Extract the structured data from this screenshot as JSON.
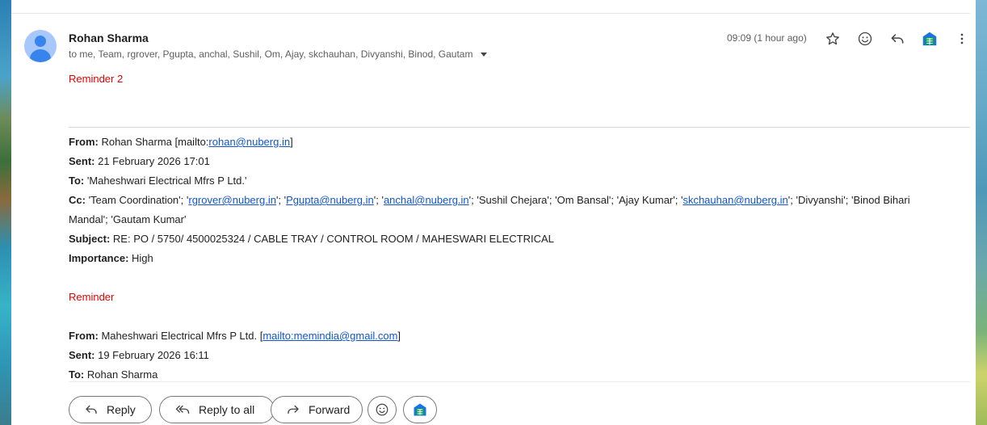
{
  "message": {
    "sender_name": "Rohan Sharma",
    "recipients": "to me, Team, rgrover, Pgupta, anchal, Sushil, Om, Ajay, skchauhan, Divyanshi, Binod, Gautam",
    "time": "09:09 (1 hour ago)",
    "reminder_label": "Reminder 2"
  },
  "quoted1": {
    "from_label": "From:",
    "from_text": " Rohan Sharma [mailto:",
    "from_link": "rohan@nuberg.in",
    "from_close": "]",
    "sent_label": "Sent:",
    "sent_value": " 21 February 2026 17:01",
    "to_label": "To:",
    "to_value": " 'Maheshwari Electrical Mfrs P Ltd.'",
    "cc_label": "Cc:",
    "cc_t1": " 'Team Coordination'; '",
    "cc_l1": "rgrover@nuberg.in",
    "cc_t2": "'; '",
    "cc_l2": "Pgupta@nuberg.in",
    "cc_t3": "'; '",
    "cc_l3": "anchal@nuberg.in",
    "cc_t4": "'; 'Sushil Chejara'; 'Om Bansal'; 'Ajay Kumar'; '",
    "cc_l4": "skchauhan@nuberg.in",
    "cc_t5": "'; 'Divyanshi'; 'Binod Bihari",
    "cc_line2": "Mandal'; 'Gautam Kumar'",
    "subject_label": "Subject:",
    "subject_value": " RE: PO / 5750/ 4500025324 / CABLE TRAY / CONTROL ROOM / MAHESWARI ELECTRICAL",
    "importance_label": "Importance:",
    "importance_value": " High",
    "reminder_label": "Reminder"
  },
  "quoted2": {
    "from_label": "From:",
    "from_text": " Maheshwari Electrical Mfrs P Ltd. [",
    "from_link": "mailto:memindia@gmail.com",
    "from_close": "]",
    "sent_label": "Sent:",
    "sent_value": " 19 February 2026 16:11",
    "to_label": "To:",
    "to_value": " Rohan Sharma"
  },
  "actions": {
    "reply": "Reply",
    "reply_all": "Reply to all",
    "forward": "Forward"
  },
  "colors": {
    "reminder": "#e00000",
    "link": "#1155cc",
    "sheets_icon": "#0f9d58"
  },
  "icons": [
    "star-icon",
    "emoji-icon",
    "reply-icon",
    "sheets-addon-icon",
    "more-vert-icon",
    "forward-icon",
    "reply-all-icon"
  ]
}
